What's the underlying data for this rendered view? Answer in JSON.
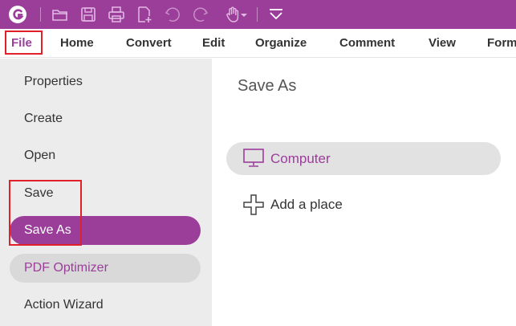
{
  "colors": {
    "accent": "#9a3e9a",
    "highlight_box": "#e0202a",
    "left_panel_bg": "#ececec"
  },
  "quick_access": {
    "icons": [
      "app-logo-icon",
      "open-folder-icon",
      "save-icon",
      "print-icon",
      "new-document-icon",
      "undo-icon",
      "redo-icon",
      "hand-tool-icon",
      "dropdown-arrow-icon",
      "customize-toolbar-icon"
    ]
  },
  "menubar": {
    "items": [
      {
        "label": "File",
        "active": true
      },
      {
        "label": "Home"
      },
      {
        "label": "Convert"
      },
      {
        "label": "Edit"
      },
      {
        "label": "Organize"
      },
      {
        "label": "Comment"
      },
      {
        "label": "View"
      },
      {
        "label": "Form"
      }
    ]
  },
  "left_menu": {
    "items": [
      {
        "label": "Properties"
      },
      {
        "label": "Create"
      },
      {
        "label": "Open"
      },
      {
        "label": "Save"
      },
      {
        "label": "Save As",
        "selected": true
      },
      {
        "label": "PDF Optimizer",
        "hovered": true
      },
      {
        "label": "Action Wizard"
      }
    ]
  },
  "content": {
    "title": "Save As",
    "locations": [
      {
        "label": "Computer",
        "icon": "computer-icon",
        "selected": true
      },
      {
        "label": "Add a place",
        "icon": "plus-icon"
      }
    ]
  }
}
